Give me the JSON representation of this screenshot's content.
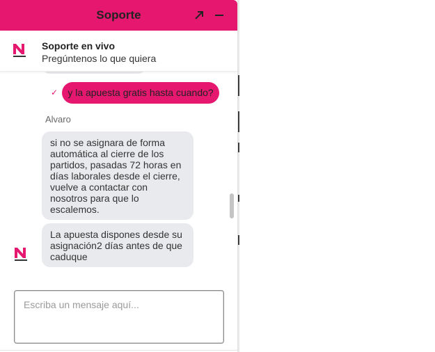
{
  "header": {
    "title": "Soporte",
    "expand_icon": "expand-arrow-icon",
    "minimize_icon": "minimize-icon",
    "background": "#e5176f"
  },
  "agent_bar": {
    "name": "Soporte en vivo",
    "subtitle": "Pregúntenos lo que quiera",
    "logo_icon": "brand-logo-icon"
  },
  "messages": {
    "user_message": "y la apuesta gratis hasta cuando?",
    "user_status_icon": "check-icon",
    "agent_name": "Alvaro",
    "agent_message_1": "si no se asignara de forma\nautomática al cierre de los\npartidos, pasadas 72 horas en\ndías laborales desde el cierre,\nvuelve a contactar con\nnosotros para que lo\nescalemos.",
    "agent_message_2": "La apuesta dispones desde su\nasignación2 días antes de que\ncaduque"
  },
  "composer": {
    "placeholder": "Escriba un mensaje aquí...",
    "value": ""
  },
  "colors": {
    "accent": "#e5176f",
    "bubble_agent": "#e9eaed"
  }
}
